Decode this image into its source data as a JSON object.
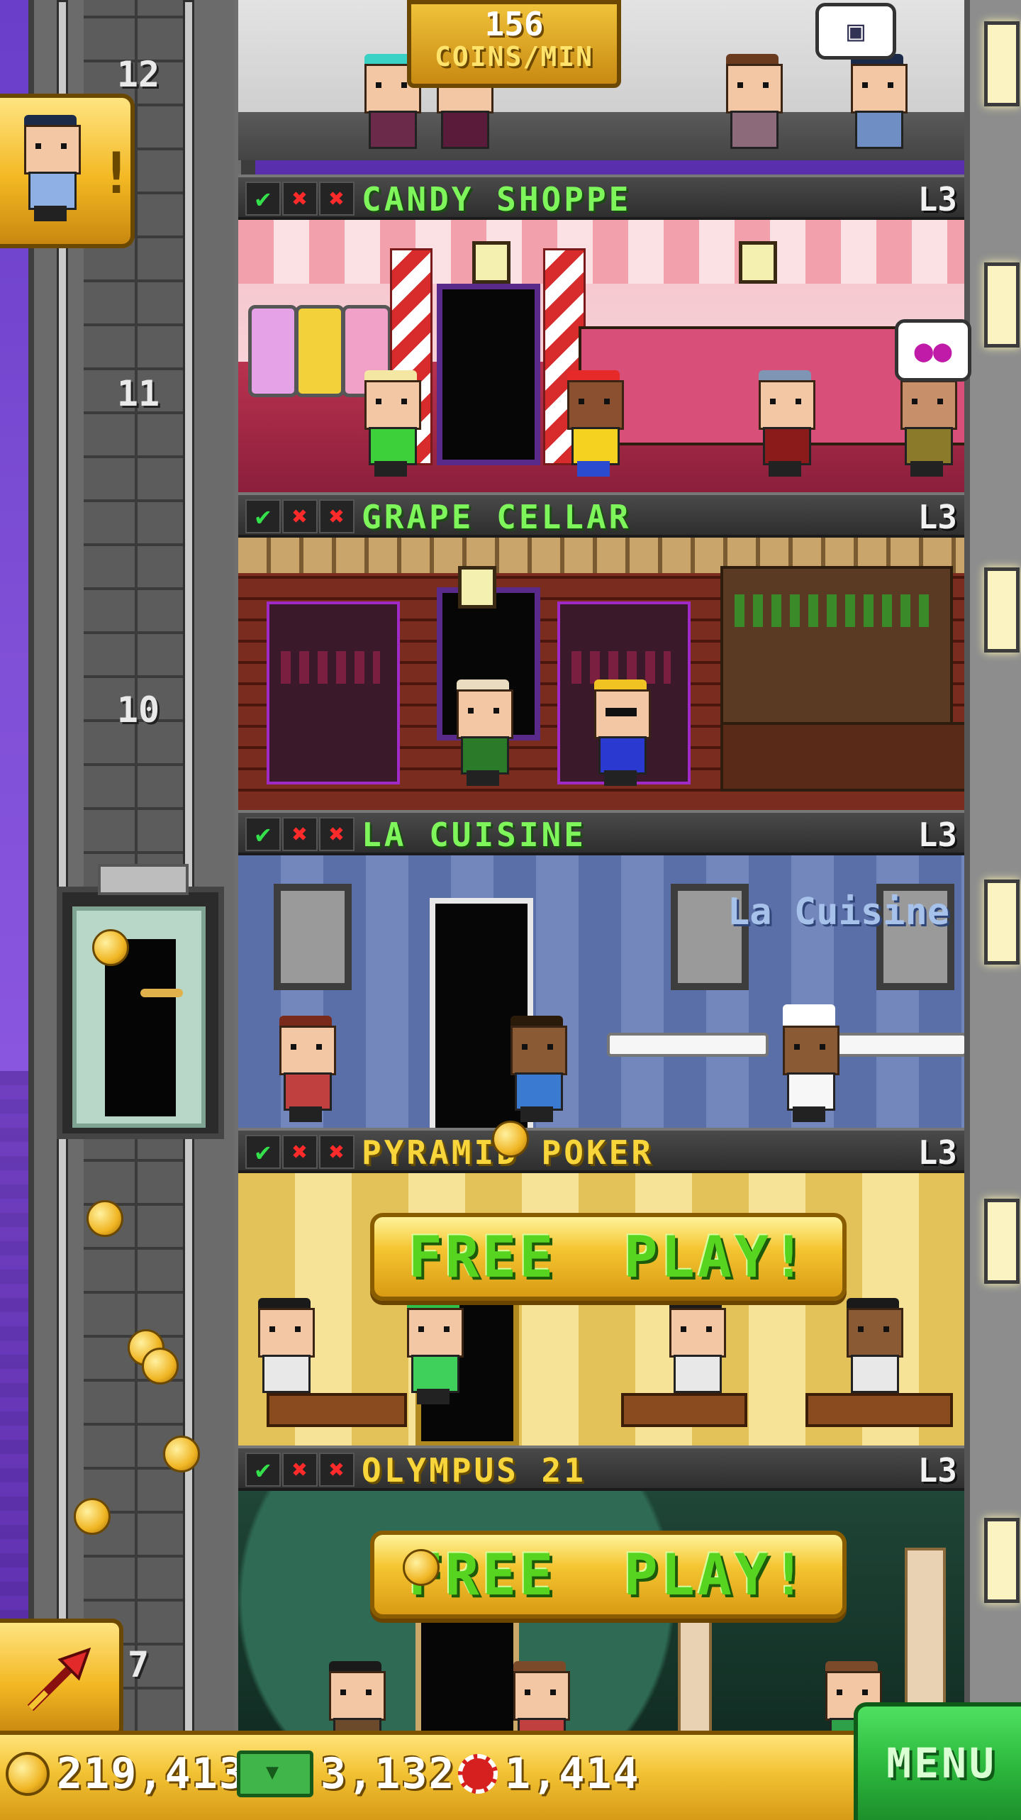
{
  "top_badge": {
    "value": "156",
    "unit": "COINS/MIN"
  },
  "shaft": {
    "floor_numbers": [
      "12",
      "11",
      "10",
      "7"
    ]
  },
  "floors": [
    {
      "name": "CANDY SHOPPE",
      "level": "L3",
      "status": [
        "check",
        "cross",
        "cross"
      ],
      "name_color": "green"
    },
    {
      "name": "GRAPE CELLAR",
      "level": "L3",
      "status": [
        "check",
        "cross",
        "cross"
      ],
      "name_color": "green"
    },
    {
      "name": "LA CUISINE",
      "level": "L3",
      "status": [
        "check",
        "cross",
        "cross"
      ],
      "name_color": "green",
      "sign": "La Cuisine"
    },
    {
      "name": "PYRAMID POKER",
      "level": "L3",
      "status": [
        "check",
        "cross",
        "cross"
      ],
      "name_color": "gold"
    },
    {
      "name": "OLYMPUS 21",
      "level": "L3",
      "status": [
        "check",
        "cross",
        "cross"
      ],
      "name_color": "gold"
    }
  ],
  "free_play": {
    "label_left": "FREE",
    "label_right": "PLAY!"
  },
  "bottom_bar": {
    "coins": "219,413",
    "bux": "3,132",
    "chips": "1,414",
    "menu_label": "MENU"
  },
  "icons": [
    "coin-icon",
    "tower-bux-icon",
    "casino-chip-icon",
    "rocket-icon",
    "checkmark-icon",
    "cross-icon",
    "speech-bubble-icon"
  ],
  "colors": {
    "green_text": "#7ef55a",
    "gold_text": "#f8d63b",
    "menu_green": "#2ebb3f",
    "bar_gold": "#f2c233"
  }
}
